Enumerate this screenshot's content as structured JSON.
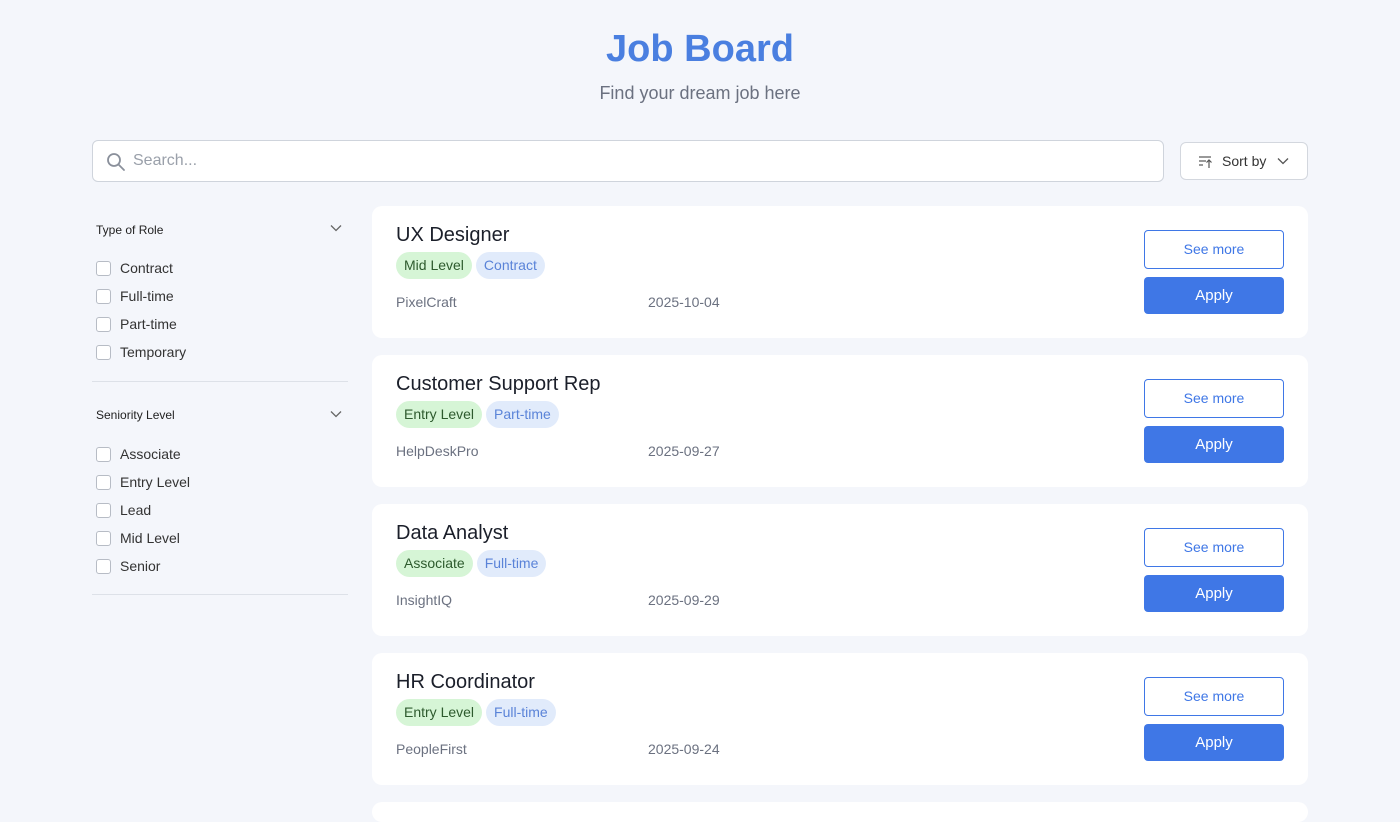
{
  "header": {
    "title": "Job Board",
    "subtitle": "Find your dream job here"
  },
  "search": {
    "placeholder": "Search...",
    "value": ""
  },
  "sort": {
    "label": "Sort by"
  },
  "filters": [
    {
      "label": "Type of Role",
      "options": [
        "Contract",
        "Full-time",
        "Part-time",
        "Temporary"
      ]
    },
    {
      "label": "Seniority Level",
      "options": [
        "Associate",
        "Entry Level",
        "Lead",
        "Mid Level",
        "Senior"
      ]
    }
  ],
  "jobs": [
    {
      "title": "UX Designer",
      "level": "Mid Level",
      "type": "Contract",
      "company": "PixelCraft",
      "date": "2025-10-04",
      "see_more": "See more",
      "apply": "Apply"
    },
    {
      "title": "Customer Support Rep",
      "level": "Entry Level",
      "type": "Part-time",
      "company": "HelpDeskPro",
      "date": "2025-09-27",
      "see_more": "See more",
      "apply": "Apply"
    },
    {
      "title": "Data Analyst",
      "level": "Associate",
      "type": "Full-time",
      "company": "InsightIQ",
      "date": "2025-09-29",
      "see_more": "See more",
      "apply": "Apply"
    },
    {
      "title": "HR Coordinator",
      "level": "Entry Level",
      "type": "Full-time",
      "company": "PeopleFirst",
      "date": "2025-09-24",
      "see_more": "See more",
      "apply": "Apply"
    }
  ],
  "colors": {
    "accent": "#3f77e6",
    "title": "#4a7fe0",
    "level_tag_bg": "#d6f5d6",
    "type_tag_bg": "#e1ebfb",
    "background": "#f4f6fb"
  }
}
